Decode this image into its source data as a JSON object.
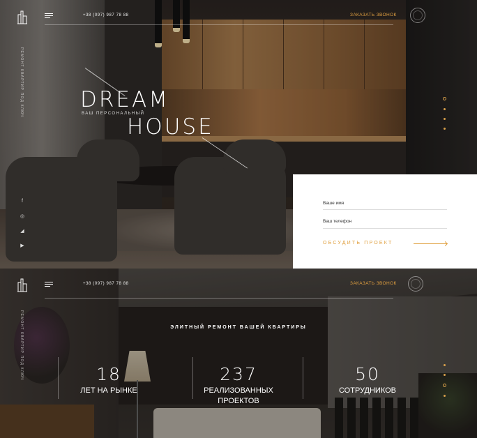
{
  "hero": {
    "phone": "+38 (097) 987 78 88",
    "callback": "ЗАКАЗАТЬ ЗВОНОК",
    "side_text": "РЕМОНТ КВАРТИР ПОД КЛЮЧ",
    "title_line1": "DREAM",
    "title_line2": "HOUSE",
    "subtitle": "ВАШ ПЕРСОНАЛЬНЫЙ",
    "social": [
      "f",
      "◎",
      "◢",
      "▶"
    ],
    "form": {
      "name_placeholder": "Ваше имя",
      "phone_placeholder": "Ваш телефон",
      "submit": "ОБСУДИТЬ ПРОЕКТ"
    }
  },
  "stats": {
    "phone": "+38 (097) 987 78 88",
    "callback": "ЗАКАЗАТЬ ЗВОНОК",
    "side_text": "РЕМОНТ КВАРТИР ПОД КЛЮЧ",
    "heading": "ЭЛИТНЫЙ РЕМОНТ ВАШЕЙ КВАРТИРЫ",
    "items": [
      {
        "value": "18",
        "label": "ЛЕТ НА РЫНКЕ"
      },
      {
        "value": "237",
        "label": "РЕАЛИЗОВАННЫХ ПРОЕКТОВ"
      },
      {
        "value": "50",
        "label": "СОТРУДНИКОВ"
      }
    ]
  },
  "colors": {
    "accent": "#e0a040",
    "form_bg": "#ffffff"
  },
  "icons": {
    "logo": "building-logo-icon",
    "menu": "hamburger-menu-icon",
    "arrow": "arrow-right-icon"
  }
}
